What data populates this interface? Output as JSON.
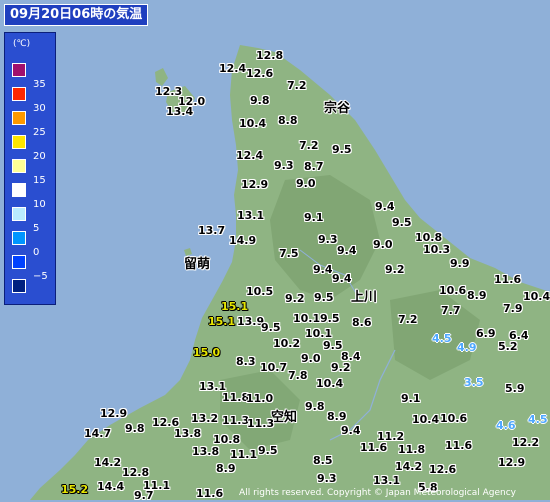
{
  "title": "09月20日06時の気温",
  "legend": {
    "unit": "(℃)",
    "items": [
      {
        "label": "",
        "color": "#a0106e"
      },
      {
        "label": "35",
        "color": "#ff2800"
      },
      {
        "label": "30",
        "color": "#ff9900"
      },
      {
        "label": "25",
        "color": "#ffe600"
      },
      {
        "label": "20",
        "color": "#ffff96"
      },
      {
        "label": "15",
        "color": "#ffffff"
      },
      {
        "label": "10",
        "color": "#b9ebff"
      },
      {
        "label": "5",
        "color": "#0096ff"
      },
      {
        "label": "0",
        "color": "#0041ff"
      },
      {
        "label": "−5",
        "color": "#002080"
      }
    ]
  },
  "places": [
    {
      "name": "宗谷"
    },
    {
      "name": "留萌"
    },
    {
      "name": "上川"
    },
    {
      "name": "空知"
    }
  ],
  "values": [
    "12.8",
    "12.4",
    "12.6",
    "7.2",
    "12.3",
    "12.0",
    "13.4",
    "9.8",
    "10.4",
    "8.8",
    "7.2",
    "9.5",
    "12.4",
    "9.3",
    "8.7",
    "12.9",
    "9.0",
    "13.1",
    "9.1",
    "9.4",
    "9.5",
    "13.7",
    "14.9",
    "9.3",
    "10.8",
    "9.4",
    "9.0",
    "10.3",
    "7.5",
    "9.4",
    "9.2",
    "9.9",
    "9.4",
    "11.6",
    "10.5",
    "9.2",
    "9.5",
    "10.6",
    "8.9",
    "10.4",
    "15.1",
    "7.9",
    "15.1",
    "13.9",
    "9.5",
    "10.1",
    "9.5",
    "8.6",
    "7.2",
    "7.7",
    "10.1",
    "4.5",
    "6.9",
    "6.4",
    "10.2",
    "9.5",
    "4.9",
    "5.2",
    "15.0",
    "8.4",
    "8.3",
    "10.7",
    "9.0",
    "9.2",
    "7.8",
    "3.5",
    "10.4",
    "5.9",
    "13.1",
    "11.8",
    "11.0",
    "9.8",
    "9.1",
    "12.9",
    "13.2",
    "11.3",
    "11.3",
    "8.9",
    "10.4",
    "10.6",
    "4.5",
    "9.8",
    "12.6",
    "14.7",
    "13.8",
    "9.4",
    "4.6",
    "10.8",
    "11.2",
    "12.2",
    "13.8",
    "9.5",
    "11.6",
    "11.8",
    "11.6",
    "14.2",
    "11.1",
    "8.5",
    "8.9",
    "12.9",
    "12.8",
    "14.2",
    "12.6",
    "9.3",
    "13.1",
    "14.4",
    "15.2",
    "9.7",
    "11.1",
    "11.6",
    "5.8"
  ],
  "copyright": "All rights reserved. Copyright © Japan Meteorological Agency"
}
